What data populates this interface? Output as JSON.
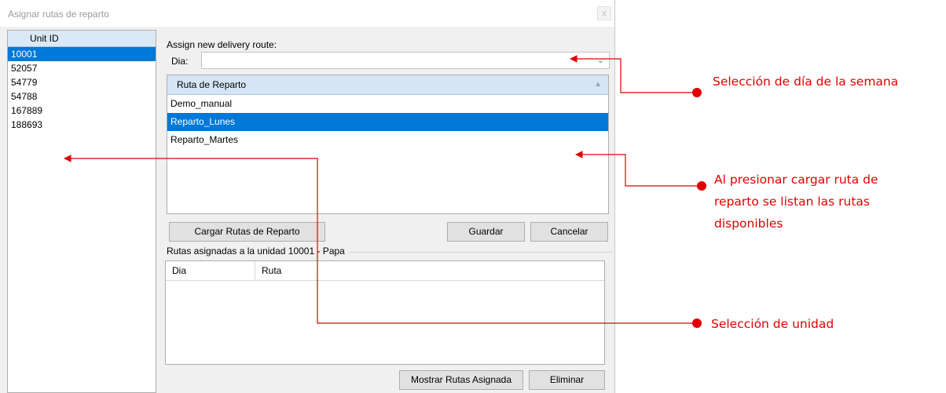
{
  "window": {
    "title": "Asignar rutas de reparto",
    "close_glyph": "x"
  },
  "unit_list": {
    "header": "Unit ID",
    "items": [
      "10001",
      "52057",
      "54779",
      "54788",
      "167889",
      "188693"
    ],
    "selected_index": 0
  },
  "assign": {
    "label": "Assign new delivery route:",
    "dia_label": "Dia:",
    "dia_value": ""
  },
  "route_list": {
    "header": "Ruta de Reparto",
    "items": [
      "Demo_manual",
      "Reparto_Lunes",
      "Reparto_Martes"
    ],
    "selected_index": 1
  },
  "buttons": {
    "load_routes": "Cargar Rutas de Reparto",
    "save": "Guardar",
    "cancel": "Cancelar",
    "show_assigned": "Mostrar Rutas Asignada",
    "delete": "Eliminar"
  },
  "assigned": {
    "group_title": "Rutas asignadas a la unidad 10001 - Papa",
    "columns": [
      "Dia",
      "Ruta"
    ]
  },
  "annotations": {
    "day_select": "Selección de día de la semana",
    "load_routes_note": [
      "Al presionar cargar ruta de",
      "reparto se listan las rutas",
      "disponibles"
    ],
    "unit_select": "Selección de unidad"
  },
  "colors": {
    "selection": "#0078d7",
    "annotation": "#e00000"
  }
}
